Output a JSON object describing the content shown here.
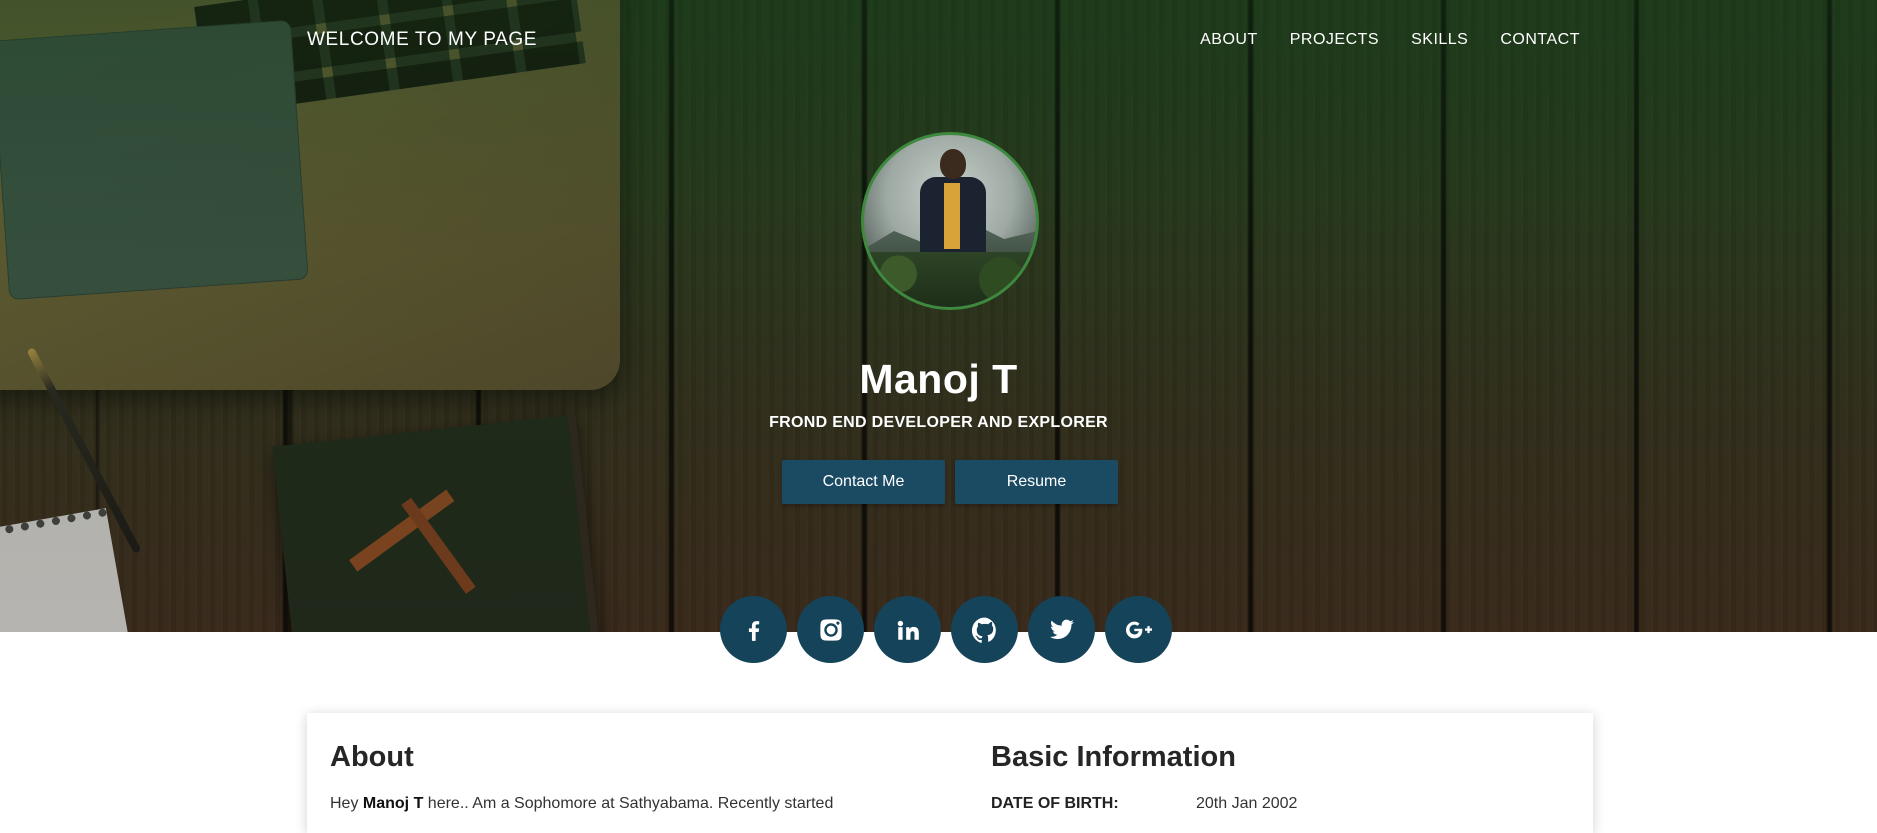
{
  "nav": {
    "brand": "WELCOME TO MY PAGE",
    "links": [
      "ABOUT",
      "PROJECTS",
      "SKILLS",
      "CONTACT"
    ]
  },
  "hero": {
    "name": "Manoj T",
    "tagline": "FROND END DEVELOPER AND EXPLORER",
    "buttons": {
      "contact": "Contact Me",
      "resume": "Resume"
    },
    "avatar_icon": "profile-photo"
  },
  "socials": [
    {
      "icon": "facebook-icon",
      "glyph": "f"
    },
    {
      "icon": "instagram-icon",
      "glyph": ""
    },
    {
      "icon": "linkedin-icon",
      "glyph": "in"
    },
    {
      "icon": "github-icon",
      "glyph": ""
    },
    {
      "icon": "twitter-icon",
      "glyph": ""
    },
    {
      "icon": "google-plus-icon",
      "glyph": "G+"
    }
  ],
  "about": {
    "title": "About",
    "text_prefix": "Hey ",
    "text_name": "Manoj T",
    "text_suffix": " here.. Am a Sophomore at Sathyabama. Recently started"
  },
  "basic_info": {
    "title": "Basic Information",
    "dob_label": "DATE OF BIRTH:",
    "dob_value": "20th Jan 2002"
  },
  "colors": {
    "button": "#1b4a63",
    "social": "#15435a",
    "avatar_ring": "#3d8a3e"
  }
}
